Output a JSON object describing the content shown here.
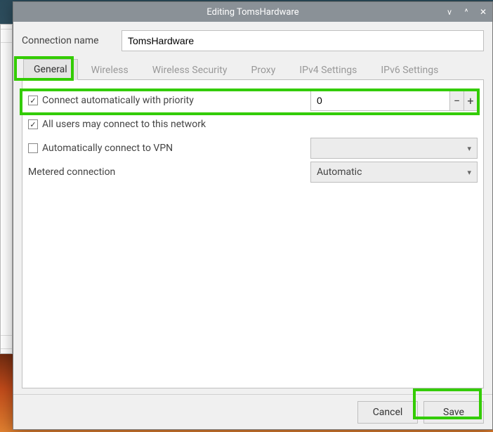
{
  "window": {
    "title": "Editing TomsHardware"
  },
  "connection": {
    "name_label": "Connection name",
    "name_value": "TomsHardware"
  },
  "tabs": {
    "general": "General",
    "wireless": "Wireless",
    "wireless_security": "Wireless Security",
    "proxy": "Proxy",
    "ipv4": "IPv4 Settings",
    "ipv6": "IPv6 Settings"
  },
  "general": {
    "auto_connect_label": "Connect automatically with priority",
    "auto_connect_checked": true,
    "priority_value": "0",
    "all_users_label": "All users may connect to this network",
    "all_users_checked": true,
    "vpn_label": "Automatically connect to VPN",
    "vpn_checked": false,
    "vpn_select_value": "",
    "metered_label": "Metered connection",
    "metered_value": "Automatic"
  },
  "buttons": {
    "cancel": "Cancel",
    "save": "Save"
  },
  "icons": {
    "minimize": "v",
    "maximize": "^",
    "close": "✕",
    "minus": "−",
    "plus": "+",
    "chevron_down": "▾"
  }
}
